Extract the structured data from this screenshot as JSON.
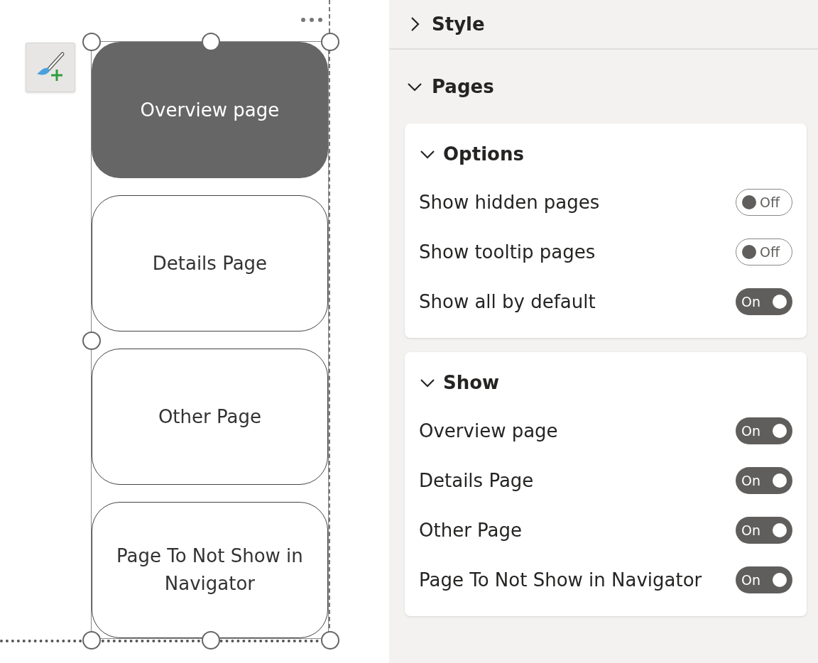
{
  "navigator": {
    "buttons": [
      {
        "label": "Overview page",
        "selected": true
      },
      {
        "label": "Details Page",
        "selected": false
      },
      {
        "label": "Other Page",
        "selected": false
      },
      {
        "label": "Page To Not Show in Navigator",
        "selected": false
      }
    ]
  },
  "format_pane": {
    "sections": [
      {
        "title": "Style",
        "expanded": false
      },
      {
        "title": "Pages",
        "expanded": true,
        "cards": [
          {
            "title": "Options",
            "expanded": true,
            "rows": [
              {
                "label": "Show hidden pages",
                "on": false,
                "state_text": "Off"
              },
              {
                "label": "Show tooltip pages",
                "on": false,
                "state_text": "Off"
              },
              {
                "label": "Show all by default",
                "on": true,
                "state_text": "On"
              }
            ]
          },
          {
            "title": "Show",
            "expanded": true,
            "rows": [
              {
                "label": "Overview page",
                "on": true,
                "state_text": "On"
              },
              {
                "label": "Details Page",
                "on": true,
                "state_text": "On"
              },
              {
                "label": "Other Page",
                "on": true,
                "state_text": "On"
              },
              {
                "label": "Page To Not Show in Navigator",
                "on": true,
                "state_text": "On"
              }
            ]
          }
        ]
      }
    ]
  }
}
